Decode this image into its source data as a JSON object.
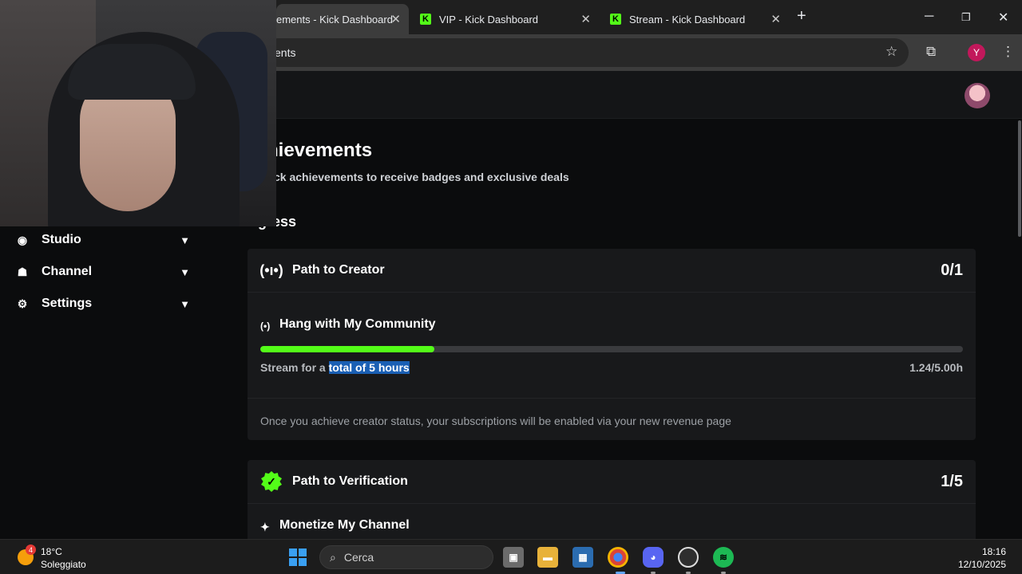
{
  "browser": {
    "tabs": [
      {
        "label": "ements - Kick Dashboard",
        "active": true
      },
      {
        "label": "VIP - Kick Dashboard",
        "active": false
      },
      {
        "label": "Stream - Kick Dashboard",
        "active": false
      }
    ],
    "new_tab": "+",
    "address": "ents",
    "profile_initial": "Y"
  },
  "sidebar": {
    "items": [
      {
        "label": "Studio",
        "icon": "studio-icon"
      },
      {
        "label": "Channel",
        "icon": "channel-icon"
      },
      {
        "label": "Settings",
        "icon": "gear-icon"
      }
    ]
  },
  "page": {
    "title": "hievements",
    "subtitle": "ck achievements to receive badges and exclusive deals",
    "section": "ogress"
  },
  "cards": [
    {
      "title": "Path to Creator",
      "count": "0/1",
      "achievement": {
        "title": "Hang with My Community",
        "desc_prefix": "Stream for a ",
        "desc_highlight": "total of 5 hours",
        "value": "1.24/5.00h",
        "progress": 0.248
      },
      "note": "Once you achieve creator status, your subscriptions will be enabled via your new revenue page"
    },
    {
      "title": "Path to Verification",
      "count": "1/5",
      "next_achievement": "Monetize My Channel"
    }
  ],
  "taskbar": {
    "weather_temp": "18°C",
    "weather_desc": "Soleggiato",
    "weather_badge": "4",
    "search_placeholder": "Cerca",
    "time": "18:16",
    "date": "12/10/2025"
  },
  "colors": {
    "accent": "#53fc18",
    "selection": "#1a5fb4"
  }
}
